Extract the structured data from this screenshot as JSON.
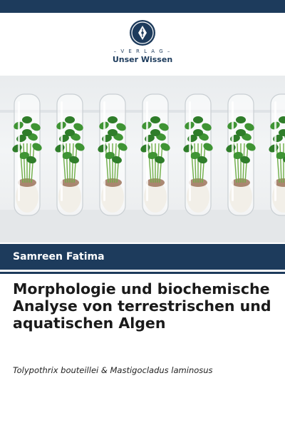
{
  "publisher": {
    "small_label": "V E R L A G",
    "name": "Unser Wissen",
    "logo_icon": "fountain-pen-nib-icon"
  },
  "cover_image": {
    "subject": "test tubes with plant seedlings",
    "tube_count": 7
  },
  "author": "Samreen Fatima",
  "title": "Morphologie und biochemische Analyse von terrestrischen und aquatischen Algen",
  "subtitle": "Tolypothrix bouteillei & Mastigocladus laminosus",
  "colors": {
    "brand": "#1d3b5c",
    "title_text": "#1a1a1a",
    "background": "#ffffff"
  }
}
